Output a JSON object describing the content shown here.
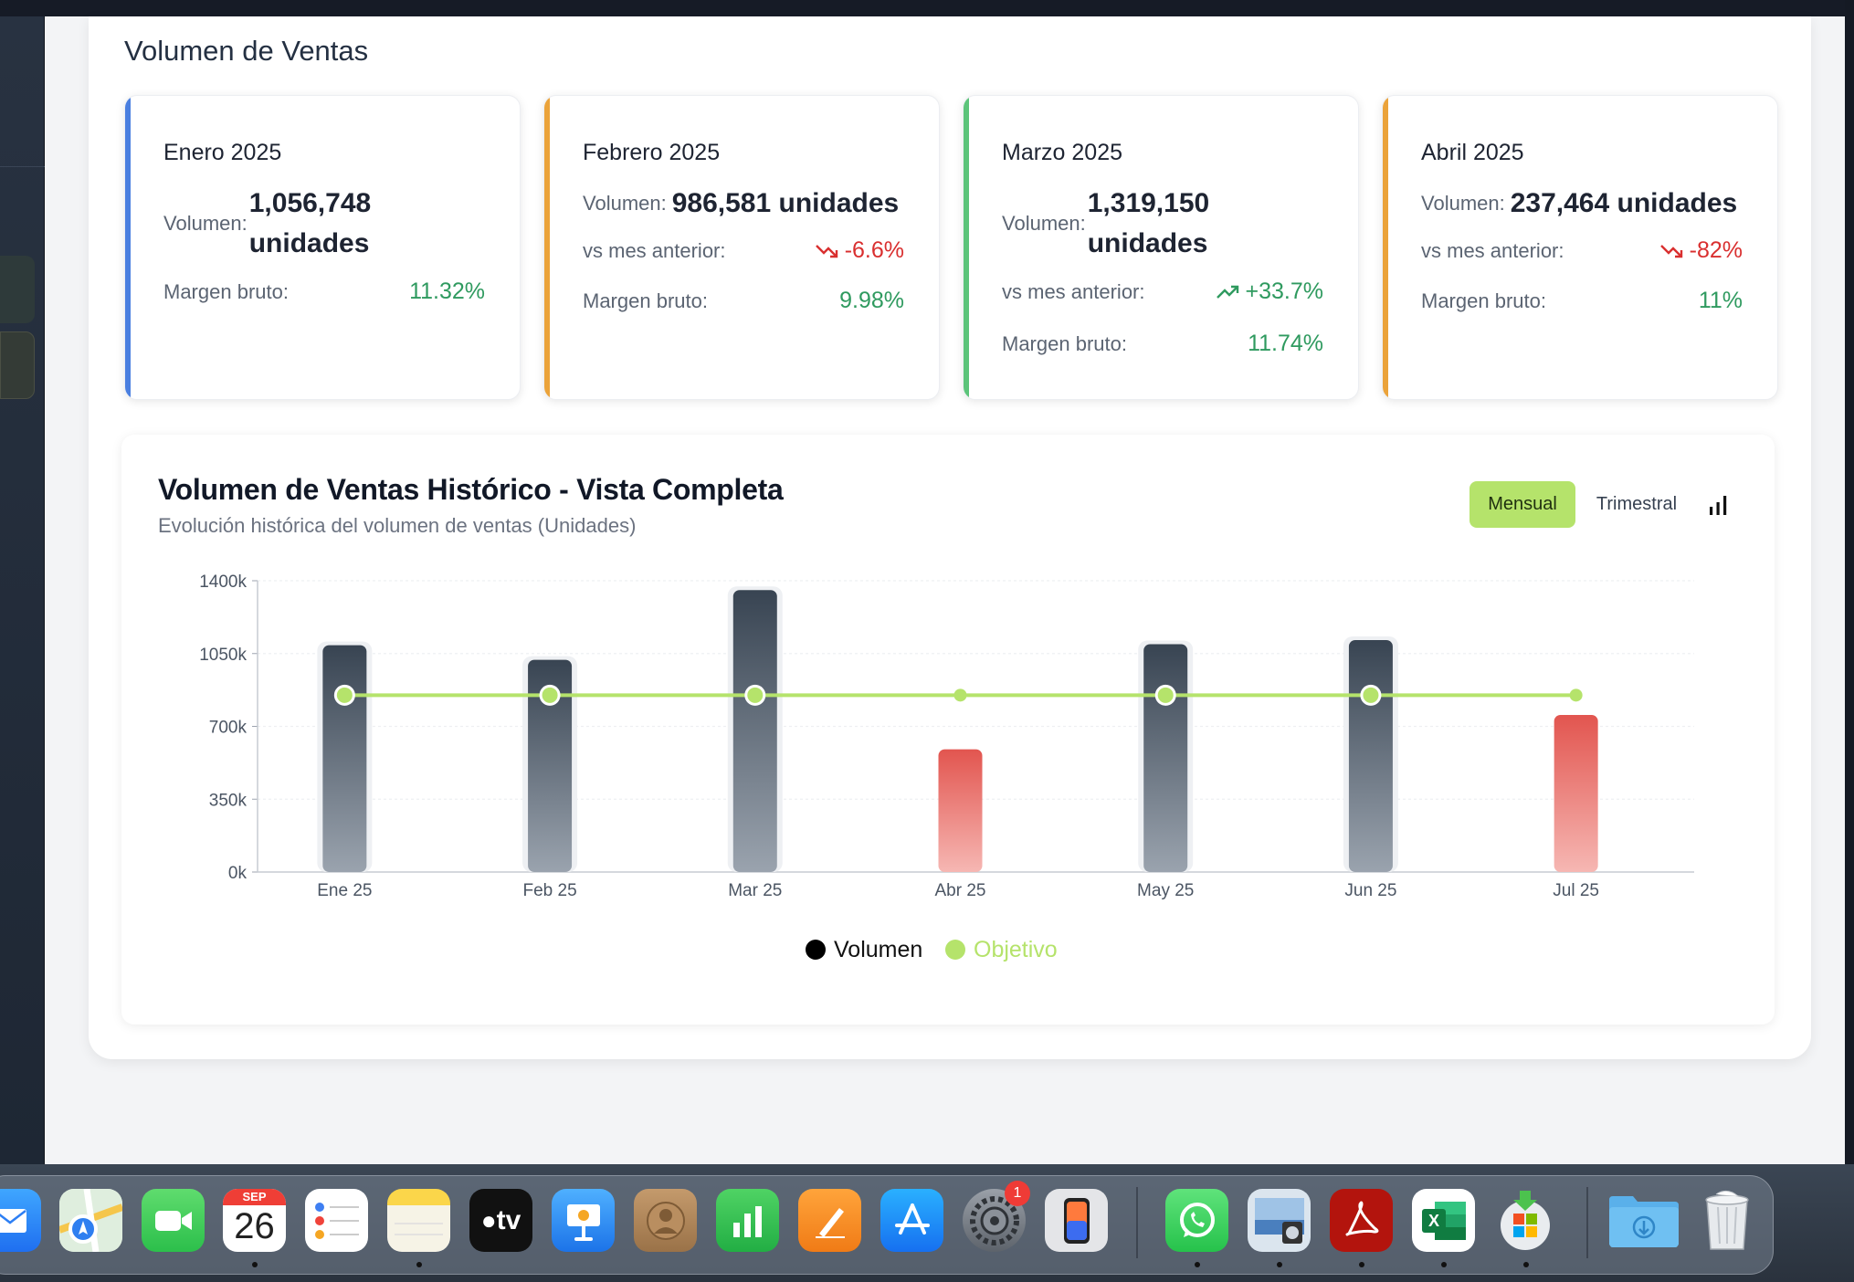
{
  "section_title": "Volumen de Ventas",
  "kpis": [
    {
      "title": "Enero 2025",
      "volume_label": "Volumen:",
      "volume_value": "1,056,748 unidades",
      "margin_label": "Margen bruto:",
      "margin_value": "11.32%",
      "accent": "#4a7fe0"
    },
    {
      "title": "Febrero 2025",
      "volume_label": "Volumen:",
      "volume_value": "986,581 unidades",
      "change_label": "vs mes anterior:",
      "change_value": "-6.6%",
      "margin_label": "Margen bruto:",
      "margin_value": "9.98%",
      "accent": "#eba33a"
    },
    {
      "title": "Marzo 2025",
      "volume_label": "Volumen:",
      "volume_value": "1,319,150 unidades",
      "change_label": "vs mes anterior:",
      "change_value": "+33.7%",
      "margin_label": "Margen bruto:",
      "margin_value": "11.74%",
      "accent": "#5cc47a"
    },
    {
      "title": "Abril 2025",
      "volume_label": "Volumen:",
      "volume_value": "237,464 unidades",
      "change_label": "vs mes anterior:",
      "change_value": "-82%",
      "margin_label": "Margen bruto:",
      "margin_value": "11%",
      "accent": "#eba33a"
    }
  ],
  "chart_card": {
    "title": "Volumen de Ventas Histórico - Vista Completa",
    "subtitle": "Evolución histórica del volumen de ventas (Unidades)",
    "buttons": {
      "monthly": "Mensual",
      "quarterly": "Trimestral"
    },
    "chart_icon": "bar-chart-icon"
  },
  "chart_data": {
    "type": "bar",
    "categories": [
      "Ene 25",
      "Feb 25",
      "Mar 25",
      "Abr 25",
      "May 25",
      "Jun 25",
      "Jul 25"
    ],
    "series": [
      {
        "name": "Volumen",
        "type": "bar",
        "values": [
          1090000,
          1020000,
          1355000,
          590000,
          1095000,
          1115000,
          755000
        ],
        "colors": [
          "#384452",
          "#384452",
          "#384452",
          "#e2554f",
          "#384452",
          "#384452",
          "#e2554f"
        ]
      },
      {
        "name": "Objetivo",
        "type": "line",
        "values": [
          850000,
          850000,
          850000,
          850000,
          850000,
          850000,
          850000
        ],
        "color": "#b5e36b"
      }
    ],
    "y_ticks": [
      "0k",
      "350k",
      "700k",
      "1050k",
      "1400k"
    ],
    "ylim": [
      0,
      1400000
    ],
    "legend_position": "bottom",
    "grid": true
  },
  "dock": {
    "calendar_month": "SEP",
    "calendar_day": "26",
    "settings_badge": "1",
    "apps": [
      "mail-icon",
      "maps-icon",
      "facetime-icon",
      "calendar-icon",
      "reminders-icon",
      "notes-icon",
      "appletv-icon",
      "keynote-icon",
      "contacts-icon",
      "numbers-icon",
      "pages-icon",
      "appstore-icon",
      "settings-icon",
      "iphone-mirroring-icon",
      "whatsapp-icon",
      "preview-icon",
      "acrobat-icon",
      "excel-icon",
      "office-installer-icon",
      "downloads-folder-icon",
      "trash-icon"
    ],
    "appletv_label": "tv"
  }
}
